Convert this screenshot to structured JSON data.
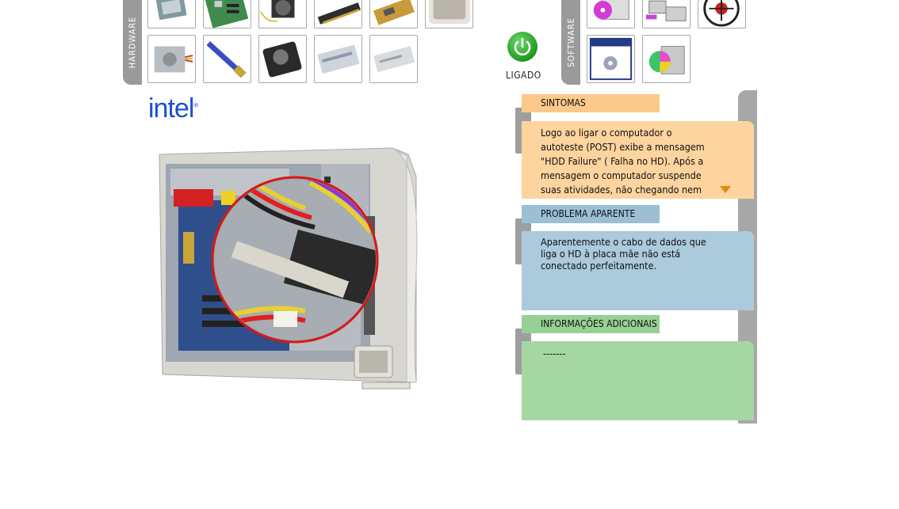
{
  "hardware_tab": {
    "label": "HARDWARE"
  },
  "software_tab": {
    "label": "SOFTWARE"
  },
  "power": {
    "label": "LIGADO"
  },
  "brand": {
    "logo_text": "intel"
  },
  "sections": {
    "sintomas": {
      "title": "SINTOMAS",
      "text": "Logo ao ligar o computador o autoteste (POST) exibe a mensagem \"HDD Failure\" ( Falha no HD). Após a mensagem o computador suspende suas atividades, não chegando nem mesmo a iniciar o"
    },
    "problema": {
      "title": "PROBLEMA APARENTE",
      "text": "Aparentemente o cabo de dados que liga o HD à placa mãe não está conectado perfeitamente."
    },
    "informacoes": {
      "title": "INFORMAÇÕES ADICIONAIS",
      "text": "-------"
    }
  },
  "colors": {
    "sintomas_head": "#fbc98a",
    "sintomas_body": "#fdd49e",
    "problema_head": "#9cbfd6",
    "problema_body": "#abcadc",
    "info_head": "#96d193",
    "info_body": "#a5d7a2",
    "tab_gray": "#9a9a9a",
    "power_green": "#22a322",
    "intel_blue": "#1b4fd0"
  },
  "icons": {
    "hardware": [
      "cpu-icon",
      "motherboard-icon",
      "cpu-cooler-icon",
      "memory-module-icon",
      "expansion-card-icon",
      "monitor-icon",
      "power-supply-icon",
      "ide-cable-icon",
      "hard-disk-icon",
      "cd-rom-drive-icon",
      "floppy-drive-icon"
    ],
    "software": [
      "software-cd-monitor-icon",
      "network-computers-icon",
      "virus-bug-icon",
      "settings-window-icon",
      "install-box-icon"
    ]
  }
}
